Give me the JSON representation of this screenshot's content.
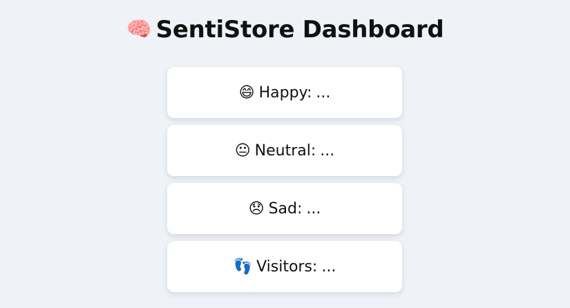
{
  "header": {
    "icon": "brain-icon",
    "icon_glyph": "🧠",
    "title": "SentiStore Dashboard"
  },
  "stats": [
    {
      "icon": "happy-face-icon",
      "glyph": "😄",
      "label": "Happy:",
      "value": "..."
    },
    {
      "icon": "neutral-face-icon",
      "glyph": "😐",
      "label": "Neutral:",
      "value": "..."
    },
    {
      "icon": "sad-face-icon",
      "glyph": "😞",
      "label": "Sad:",
      "value": "..."
    },
    {
      "icon": "footprints-icon",
      "glyph": "👣",
      "label": "Visitors:",
      "value": "..."
    }
  ],
  "colors": {
    "background": "#eff2f7",
    "card": "#ffffff",
    "text": "#111111"
  }
}
